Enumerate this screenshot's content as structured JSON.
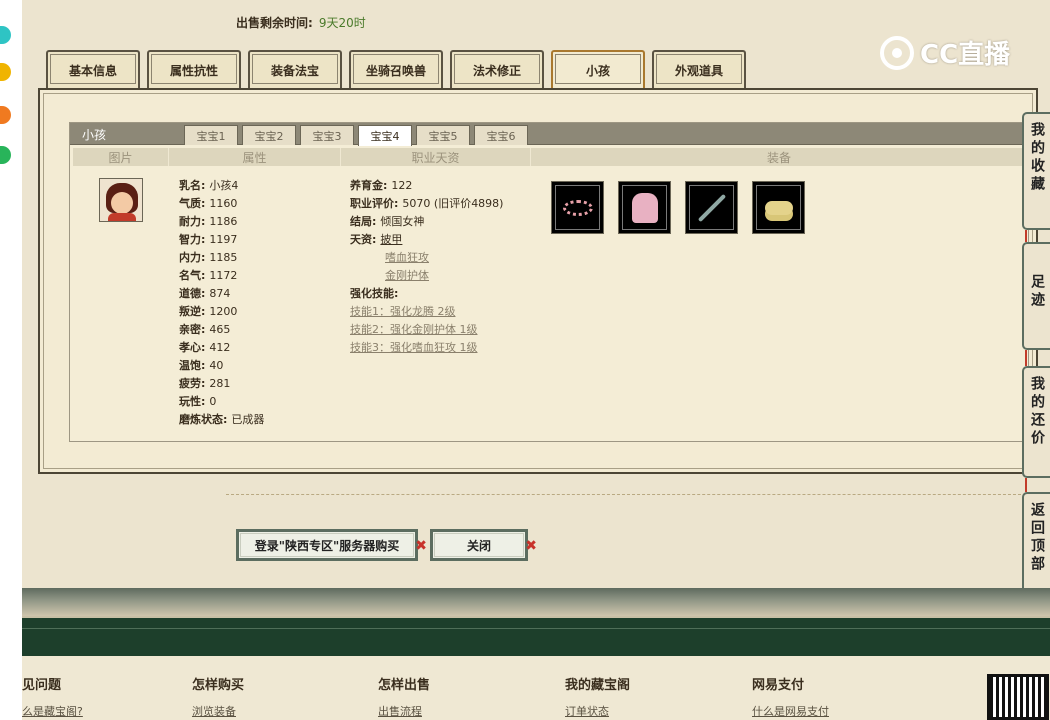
{
  "sale": {
    "label": "出售剩余时间:",
    "value": "9天20时"
  },
  "brand": {
    "name": "CC直播"
  },
  "tabs": [
    "基本信息",
    "属性抗性",
    "装备法宝",
    "坐骑召唤兽",
    "法术修正",
    "小孩",
    "外观道具"
  ],
  "kid_section": {
    "title": "小孩",
    "sub_tabs": [
      "宝宝1",
      "宝宝2",
      "宝宝3",
      "宝宝4",
      "宝宝5",
      "宝宝6"
    ],
    "active_sub_tab": 3,
    "columns": [
      "图片",
      "属性",
      "职业天资",
      "装备"
    ]
  },
  "attributes": [
    {
      "k": "乳名:",
      "v": "小孩4"
    },
    {
      "k": "气质:",
      "v": "1160"
    },
    {
      "k": "耐力:",
      "v": "1186"
    },
    {
      "k": "智力:",
      "v": "1197"
    },
    {
      "k": "内力:",
      "v": "1185"
    },
    {
      "k": "名气:",
      "v": "1172"
    },
    {
      "k": "道德:",
      "v": "874"
    },
    {
      "k": "叛逆:",
      "v": "1200"
    },
    {
      "k": "亲密:",
      "v": "465"
    },
    {
      "k": "孝心:",
      "v": "412"
    },
    {
      "k": "温饱:",
      "v": "40"
    },
    {
      "k": "疲劳:",
      "v": "281"
    },
    {
      "k": "玩性:",
      "v": "0"
    },
    {
      "k": "磨炼状态:",
      "v": "已成器"
    }
  ],
  "talent": {
    "raise_label": "养育金:",
    "raise_value": "122",
    "eval_label": "职业评价:",
    "eval_value": "5070 (旧评价4898)",
    "ending_label": "结局:",
    "ending_value": "倾国女神",
    "gift_label": "天资:",
    "gifts": [
      "披甲",
      "嗜血狂攻",
      "金刚护体"
    ],
    "skill_label": "强化技能:",
    "skills": [
      "技能1：强化龙腾 2级",
      "技能2：强化金刚护体 1级",
      "技能3：强化嗜血狂攻 1级"
    ]
  },
  "equipment": [
    "flower-wreath-icon",
    "pink-dress-icon",
    "sword-icon",
    "shoes-icon"
  ],
  "buttons": {
    "buy": "登录\"陕西专区\"服务器购买",
    "close": "关闭"
  },
  "side": {
    "favorites": "我的收藏",
    "footprints": "足迹",
    "my_bids": "我的还价",
    "back_top": "返回顶部"
  },
  "footer": [
    {
      "title": "见问题",
      "link": "么是藏宝阁?"
    },
    {
      "title": "怎样购买",
      "link": "浏览装备"
    },
    {
      "title": "怎样出售",
      "link": "出售流程"
    },
    {
      "title": "我的藏宝阁",
      "link": "订单状态"
    },
    {
      "title": "网易支付",
      "link": "什么是网易支付"
    }
  ]
}
